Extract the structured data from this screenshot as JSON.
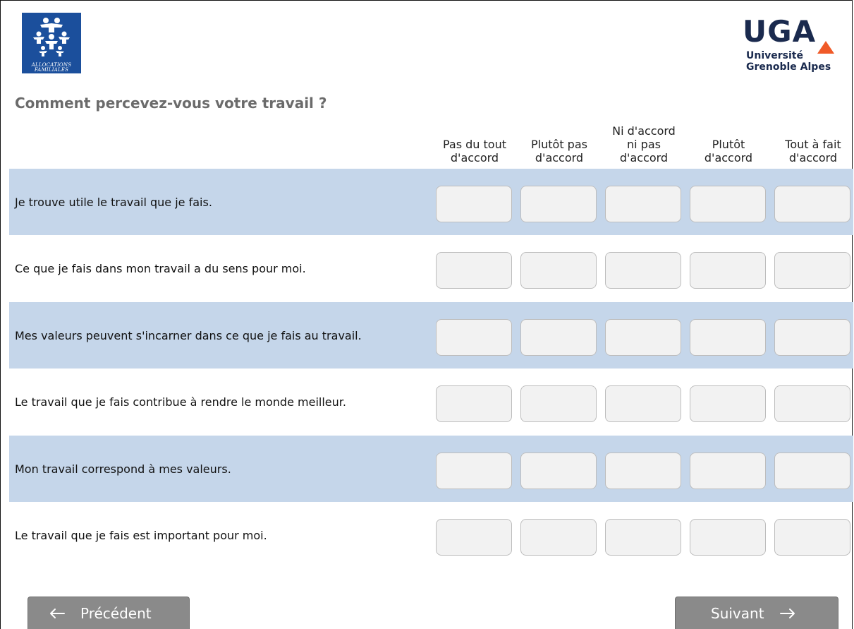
{
  "logos": {
    "caf": {
      "line1": "ALLOCATIONS",
      "line2": "FAMILIALES",
      "color": "#1b4f9c"
    },
    "uga": {
      "mark": "UGA",
      "line1": "Université",
      "line2": "Grenoble Alpes",
      "accent": "#f05a28",
      "color": "#1a2a4e"
    }
  },
  "question": {
    "title": "Comment percevez-vous votre travail ?"
  },
  "columns": [
    {
      "label": "Pas du tout\nd'accord"
    },
    {
      "label": "Plutôt pas\nd'accord"
    },
    {
      "label": "Ni d'accord\nni pas\nd'accord"
    },
    {
      "label": "Plutôt\nd'accord"
    },
    {
      "label": "Tout à fait\nd'accord"
    }
  ],
  "rows": [
    {
      "statement": "Je trouve utile le travail que je fais.",
      "selected": null
    },
    {
      "statement": "Ce que je fais dans mon travail a du sens pour moi.",
      "selected": null
    },
    {
      "statement": "Mes valeurs peuvent s'incarner dans ce que je fais au travail.",
      "selected": null
    },
    {
      "statement": "Le travail que je fais contribue à rendre le monde meilleur.",
      "selected": null
    },
    {
      "statement": "Mon travail correspond à mes valeurs.",
      "selected": null
    },
    {
      "statement": "Le travail que je fais est important pour moi.",
      "selected": null
    }
  ],
  "navigation": {
    "previous_label": "Précédent",
    "next_label": "Suivant",
    "previous_icon": "arrow-left-icon",
    "next_icon": "arrow-right-icon"
  },
  "colors": {
    "row_shade": "#c5d6ea",
    "choice_fill": "#f2f2f2",
    "button_fill": "#8a8a8a",
    "title_text": "#6b6b6b"
  }
}
